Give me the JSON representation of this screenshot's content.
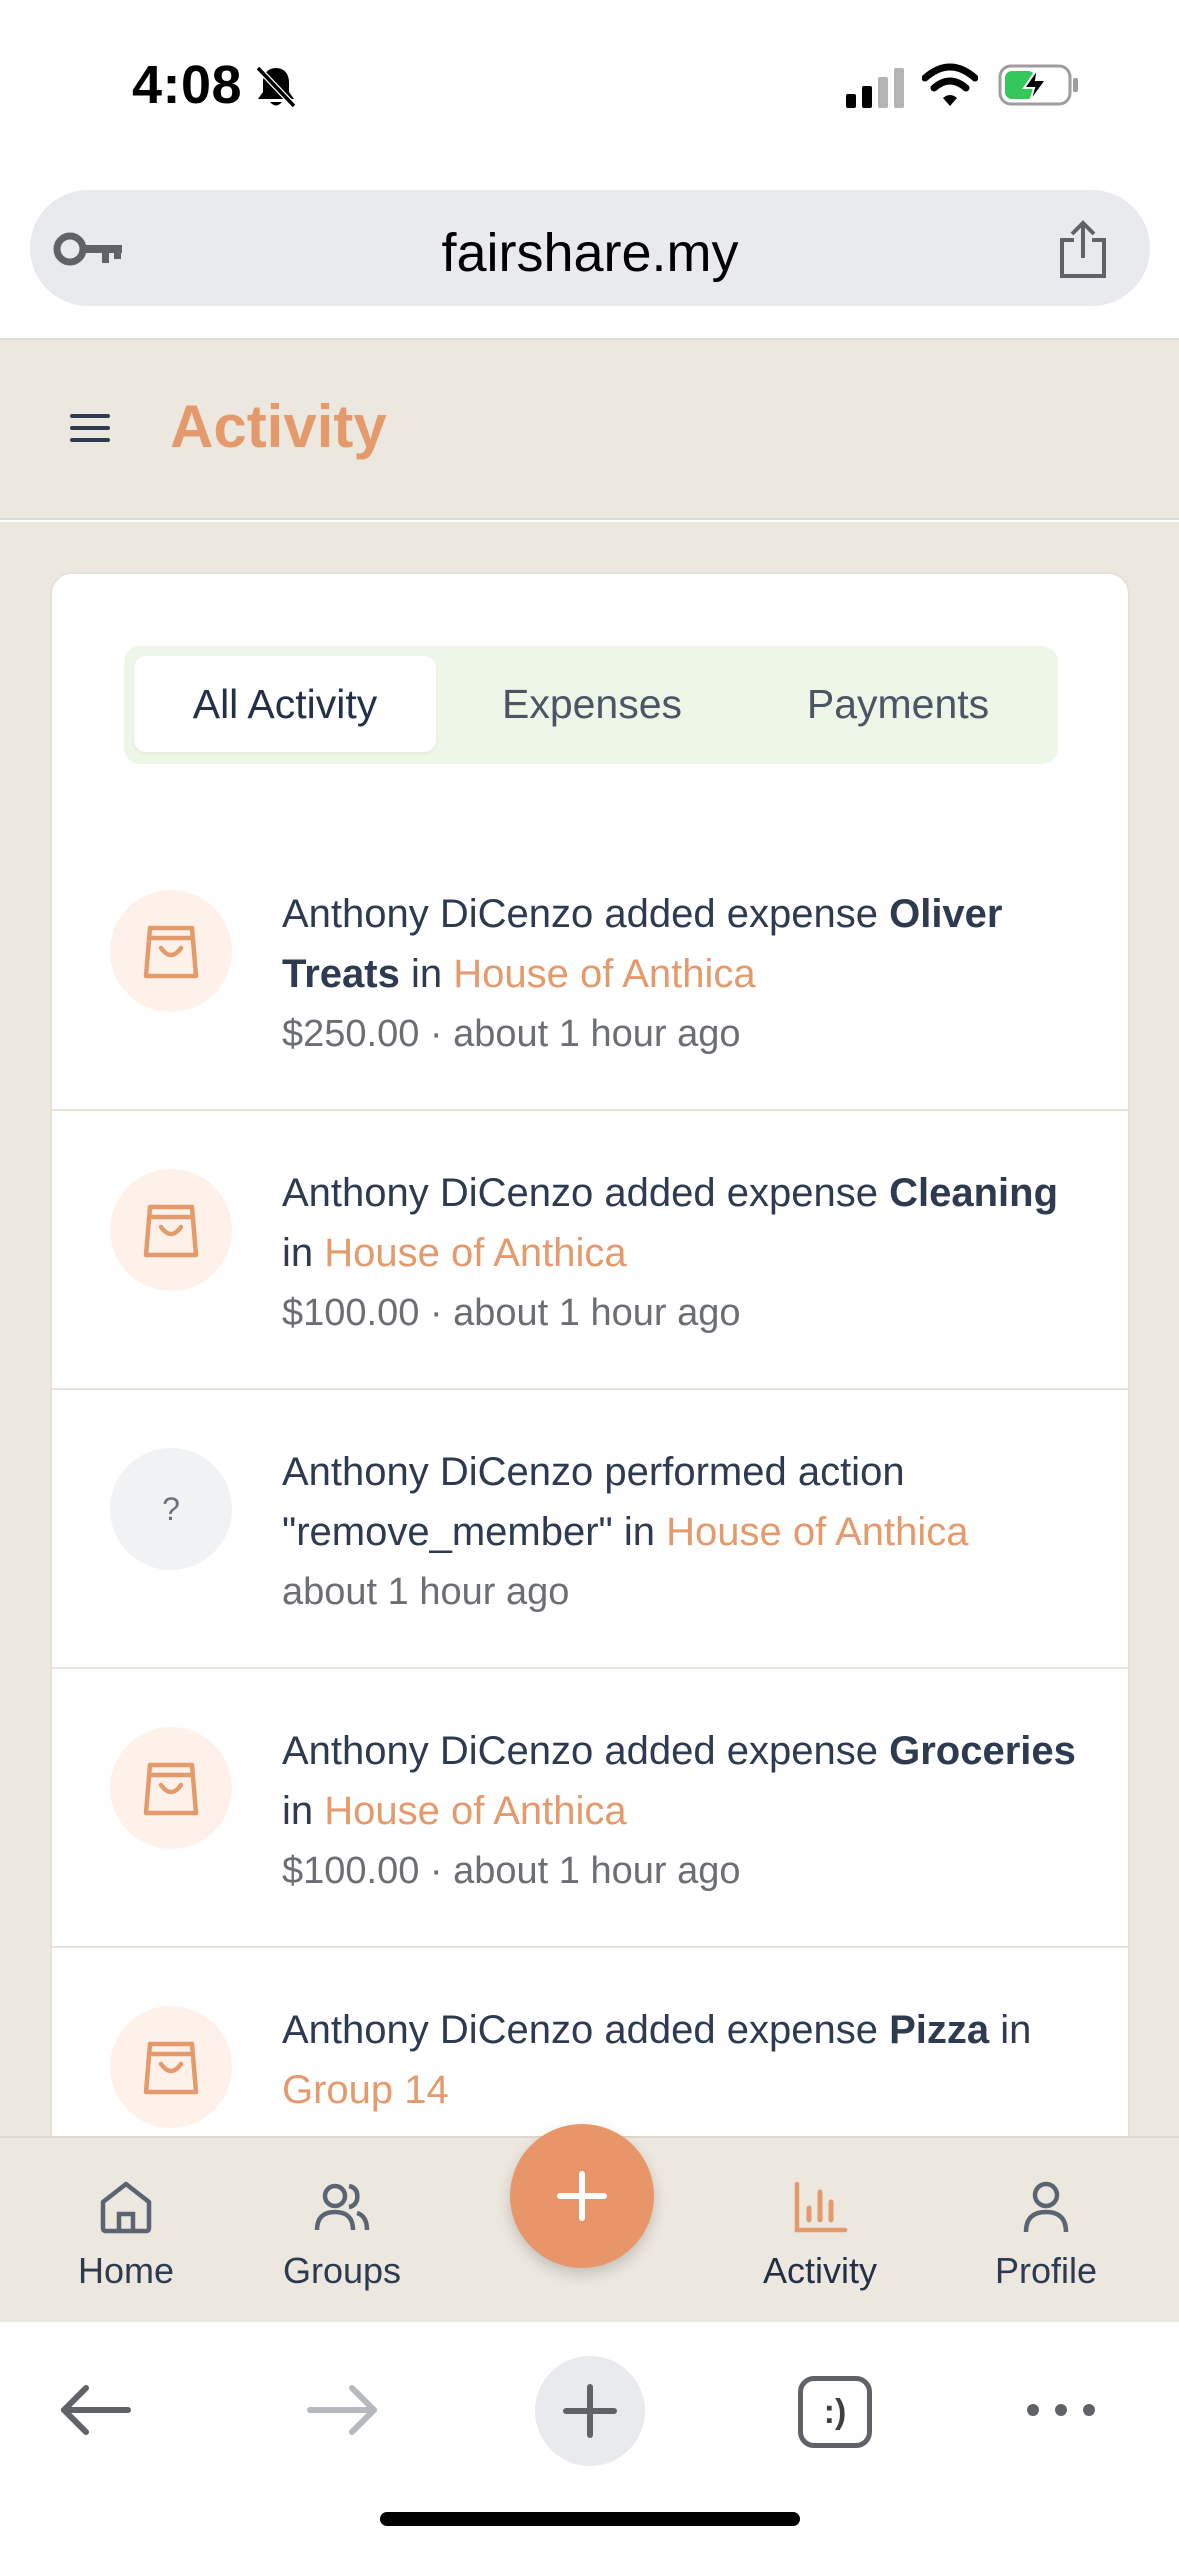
{
  "status_bar": {
    "time": "4:08",
    "icons": [
      "bell-slash-icon",
      "cellular-signal-icon",
      "wifi-icon",
      "battery-charging-icon"
    ]
  },
  "browser": {
    "url": "fairshare.my",
    "icons": [
      "key-icon",
      "share-icon"
    ],
    "toolbar_icons": [
      "back-arrow-icon",
      "forward-arrow-icon",
      "plus-icon",
      "tabs-icon",
      "more-icon"
    ],
    "tabs_glyph": ":)"
  },
  "header": {
    "title": "Activity",
    "accent_color": "#e59a6c"
  },
  "tabs": [
    {
      "label": "All Activity",
      "active": true
    },
    {
      "label": "Expenses",
      "active": false
    },
    {
      "label": "Payments",
      "active": false
    }
  ],
  "activities": [
    {
      "icon": "shopping-bag-icon",
      "actor_action": "Anthony DiCenzo added expense ",
      "subject": "Oliver Treats",
      "connector": " in ",
      "group": "House of Anthica",
      "meta": "$250.00 · about 1 hour ago"
    },
    {
      "icon": "shopping-bag-icon",
      "actor_action": "Anthony DiCenzo added expense ",
      "subject": "Cleaning",
      "connector": " in ",
      "group": "House of Anthica",
      "meta": "$100.00 · about 1 hour ago"
    },
    {
      "icon": "question-icon",
      "glyph": "?",
      "actor_action": "Anthony DiCenzo performed action \"remove_member\"",
      "subject": "",
      "connector": " in ",
      "group": "House of Anthica",
      "meta": "about 1 hour ago"
    },
    {
      "icon": "shopping-bag-icon",
      "actor_action": "Anthony DiCenzo added expense ",
      "subject": "Groceries",
      "connector": " in ",
      "group": "House of Anthica",
      "meta": "$100.00 · about 1 hour ago"
    },
    {
      "icon": "shopping-bag-icon",
      "actor_action": "Anthony DiCenzo added expense ",
      "subject": "Pizza",
      "connector": " in ",
      "group": "Group 14",
      "meta": ""
    }
  ],
  "bottom_nav": {
    "items": [
      {
        "label": "Home",
        "icon": "home-icon"
      },
      {
        "label": "Groups",
        "icon": "users-icon"
      },
      {
        "label": "Activity",
        "icon": "bar-chart-icon",
        "active": true
      },
      {
        "label": "Profile",
        "icon": "user-icon"
      }
    ],
    "fab_icon": "plus-icon",
    "fab_color": "#e8956a"
  }
}
